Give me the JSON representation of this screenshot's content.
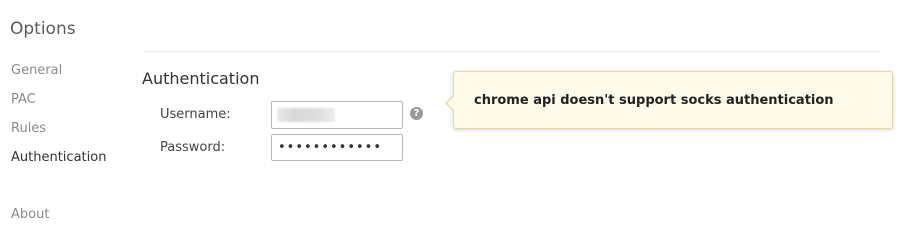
{
  "app": {
    "title": "Options"
  },
  "sidebar": {
    "items": [
      {
        "label": "General"
      },
      {
        "label": "PAC"
      },
      {
        "label": "Rules"
      },
      {
        "label": "Authentication"
      }
    ],
    "active": "Authentication",
    "about_label": "About"
  },
  "section": {
    "title": "Authentication"
  },
  "form": {
    "username_label": "Username:",
    "username_value": "",
    "password_label": "Password:",
    "password_value": "••••••••••••"
  },
  "help": {
    "icon": "question-circle-icon",
    "glyph": "?"
  },
  "tooltip": {
    "text": "chrome api doesn't support socks authentication"
  },
  "colors": {
    "tooltip_bg": "#fffbea",
    "tooltip_border": "#e6d9a8",
    "active_nav": "#333333",
    "inactive_nav": "#8a8a8a"
  }
}
